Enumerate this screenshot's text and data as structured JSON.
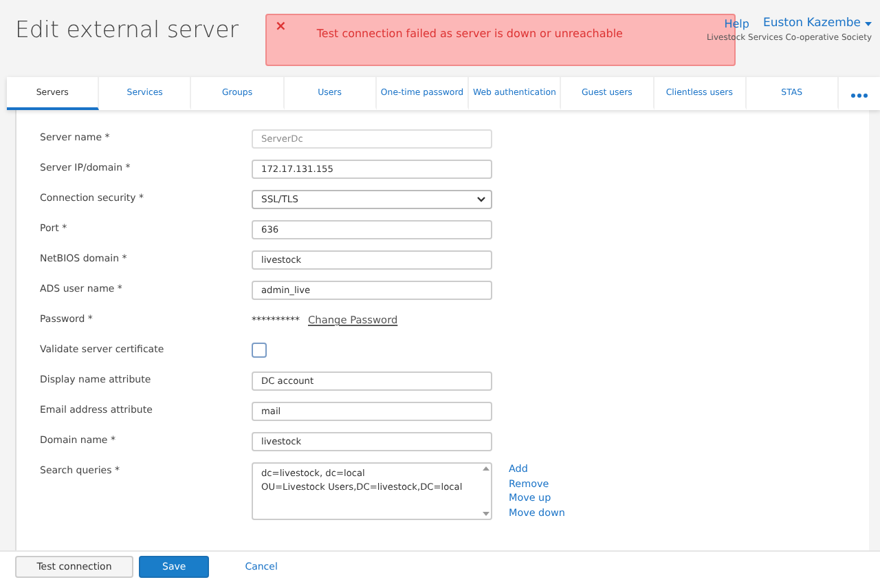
{
  "header": {
    "title": "Edit external server",
    "links": [
      "Help"
    ],
    "user": "Euston Kazembe",
    "organization": "Livestock Services Co-operative Society"
  },
  "toast": {
    "kind": "error",
    "close": "×",
    "message": "Test connection failed as server is down or unreachable"
  },
  "tabs": [
    {
      "label": "Servers",
      "selected": true
    },
    {
      "label": "Services",
      "selected": false
    },
    {
      "label": "Groups",
      "selected": false
    },
    {
      "label": "Users",
      "selected": false
    },
    {
      "label": "One-time password",
      "selected": false
    },
    {
      "label": "Web authentication",
      "selected": false
    },
    {
      "label": "Guest users",
      "selected": false
    },
    {
      "label": "Clientless users",
      "selected": false
    },
    {
      "label": "STAS",
      "selected": false
    }
  ],
  "form": [
    {
      "kind": "text",
      "label": "Server name *",
      "value": "ServerDc",
      "disabled": true
    },
    {
      "kind": "text",
      "label": "Server IP/domain *",
      "value": "172.17.131.155",
      "disabled": false
    },
    {
      "kind": "select",
      "label": "Connection security *",
      "value": "SSL/TLS"
    },
    {
      "kind": "text",
      "label": "Port *",
      "value": "636",
      "disabled": false
    },
    {
      "kind": "text",
      "label": "NetBIOS domain *",
      "value": "livestock",
      "disabled": false
    },
    {
      "kind": "text",
      "label": "ADS user name *",
      "value": "admin_live",
      "disabled": false
    },
    {
      "kind": "password",
      "label": "Password *",
      "value": "**********",
      "link": "Change Password"
    },
    {
      "kind": "checkbox",
      "label": "Validate server certificate",
      "checked": false
    },
    {
      "kind": "text",
      "label": "Display name attribute",
      "value": "DC account",
      "disabled": false
    },
    {
      "kind": "text",
      "label": "Email address attribute",
      "value": "mail",
      "disabled": false
    },
    {
      "kind": "text",
      "label": "Domain name *",
      "value": "livestock",
      "disabled": false
    },
    {
      "kind": "list",
      "label": "Search queries *",
      "items": [
        "dc=livestock, dc=local",
        "OU=Livestock Users,DC=livestock,DC=local"
      ],
      "actions": [
        "Add",
        "Remove",
        "Move up",
        "Move down"
      ]
    }
  ],
  "footer": {
    "buttons": [
      {
        "label": "Test connection",
        "kind": "secondary"
      },
      {
        "label": "Save",
        "kind": "primary"
      },
      {
        "label": "Cancel",
        "kind": "link"
      }
    ]
  }
}
